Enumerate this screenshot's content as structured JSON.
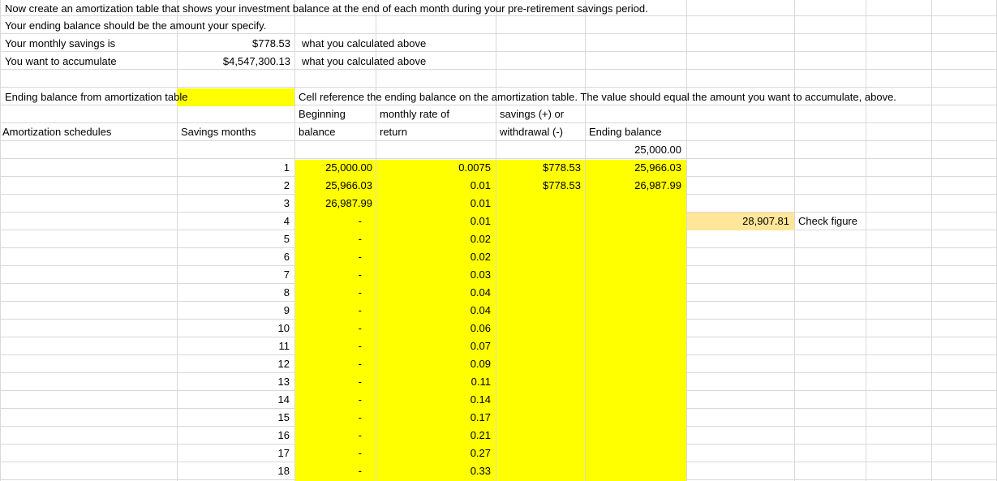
{
  "header": {
    "line1": "Now create an amortization table that shows your investment balance at the end of each month during your pre-retirement savings period.",
    "line2": "Your ending balance should be the amount your specify."
  },
  "inputs": [
    {
      "label": "Your monthly savings is",
      "value": "$778.53",
      "note": "what you calculated above"
    },
    {
      "label": "You want to accumulate",
      "value": "$4,547,300.13",
      "note": "what you calculated above"
    }
  ],
  "ending_balance": {
    "label": "Ending balance from amortization table",
    "instruction": "Cell reference the ending balance on the amortization table. The value should equal the amount you want to accumulate, above."
  },
  "columns": {
    "amort": "Amortization schedules",
    "months": "Savings months",
    "beginning_1": "Beginning",
    "beginning_2": "balance",
    "rate_1": "monthly rate of",
    "rate_2": "return",
    "savings_1": "savings (+) or",
    "savings_2": "withdrawal (-)",
    "ending": "Ending balance"
  },
  "initial_ending": "25,000.00",
  "rows": [
    {
      "month": "1",
      "beginning": "25,000.00",
      "rate": "0.0075",
      "savings": "$778.53",
      "ending": "25,966.03"
    },
    {
      "month": "2",
      "beginning": "25,966.03",
      "rate": "0.01",
      "savings": "$778.53",
      "ending": "26,987.99"
    },
    {
      "month": "3",
      "beginning": "26,987.99",
      "rate": "0.01",
      "savings": "",
      "ending": ""
    },
    {
      "month": "4",
      "beginning": "-",
      "rate": "0.01",
      "savings": "",
      "ending": ""
    },
    {
      "month": "5",
      "beginning": "-",
      "rate": "0.02",
      "savings": "",
      "ending": ""
    },
    {
      "month": "6",
      "beginning": "-",
      "rate": "0.02",
      "savings": "",
      "ending": ""
    },
    {
      "month": "7",
      "beginning": "-",
      "rate": "0.03",
      "savings": "",
      "ending": ""
    },
    {
      "month": "8",
      "beginning": "-",
      "rate": "0.04",
      "savings": "",
      "ending": ""
    },
    {
      "month": "9",
      "beginning": "-",
      "rate": "0.04",
      "savings": "",
      "ending": ""
    },
    {
      "month": "10",
      "beginning": "-",
      "rate": "0.06",
      "savings": "",
      "ending": ""
    },
    {
      "month": "11",
      "beginning": "-",
      "rate": "0.07",
      "savings": "",
      "ending": ""
    },
    {
      "month": "12",
      "beginning": "-",
      "rate": "0.09",
      "savings": "",
      "ending": ""
    },
    {
      "month": "13",
      "beginning": "-",
      "rate": "0.11",
      "savings": "",
      "ending": ""
    },
    {
      "month": "14",
      "beginning": "-",
      "rate": "0.14",
      "savings": "",
      "ending": ""
    },
    {
      "month": "15",
      "beginning": "-",
      "rate": "0.17",
      "savings": "",
      "ending": ""
    },
    {
      "month": "16",
      "beginning": "-",
      "rate": "0.21",
      "savings": "",
      "ending": ""
    },
    {
      "month": "17",
      "beginning": "-",
      "rate": "0.27",
      "savings": "",
      "ending": ""
    },
    {
      "month": "18",
      "beginning": "-",
      "rate": "0.33",
      "savings": "",
      "ending": ""
    }
  ],
  "check": {
    "value": "28,907.81",
    "label": "Check figure"
  },
  "colors": {
    "highlight": "#ffff00",
    "check_fill": "#ffe699",
    "gridline": "#d9d9d9"
  }
}
